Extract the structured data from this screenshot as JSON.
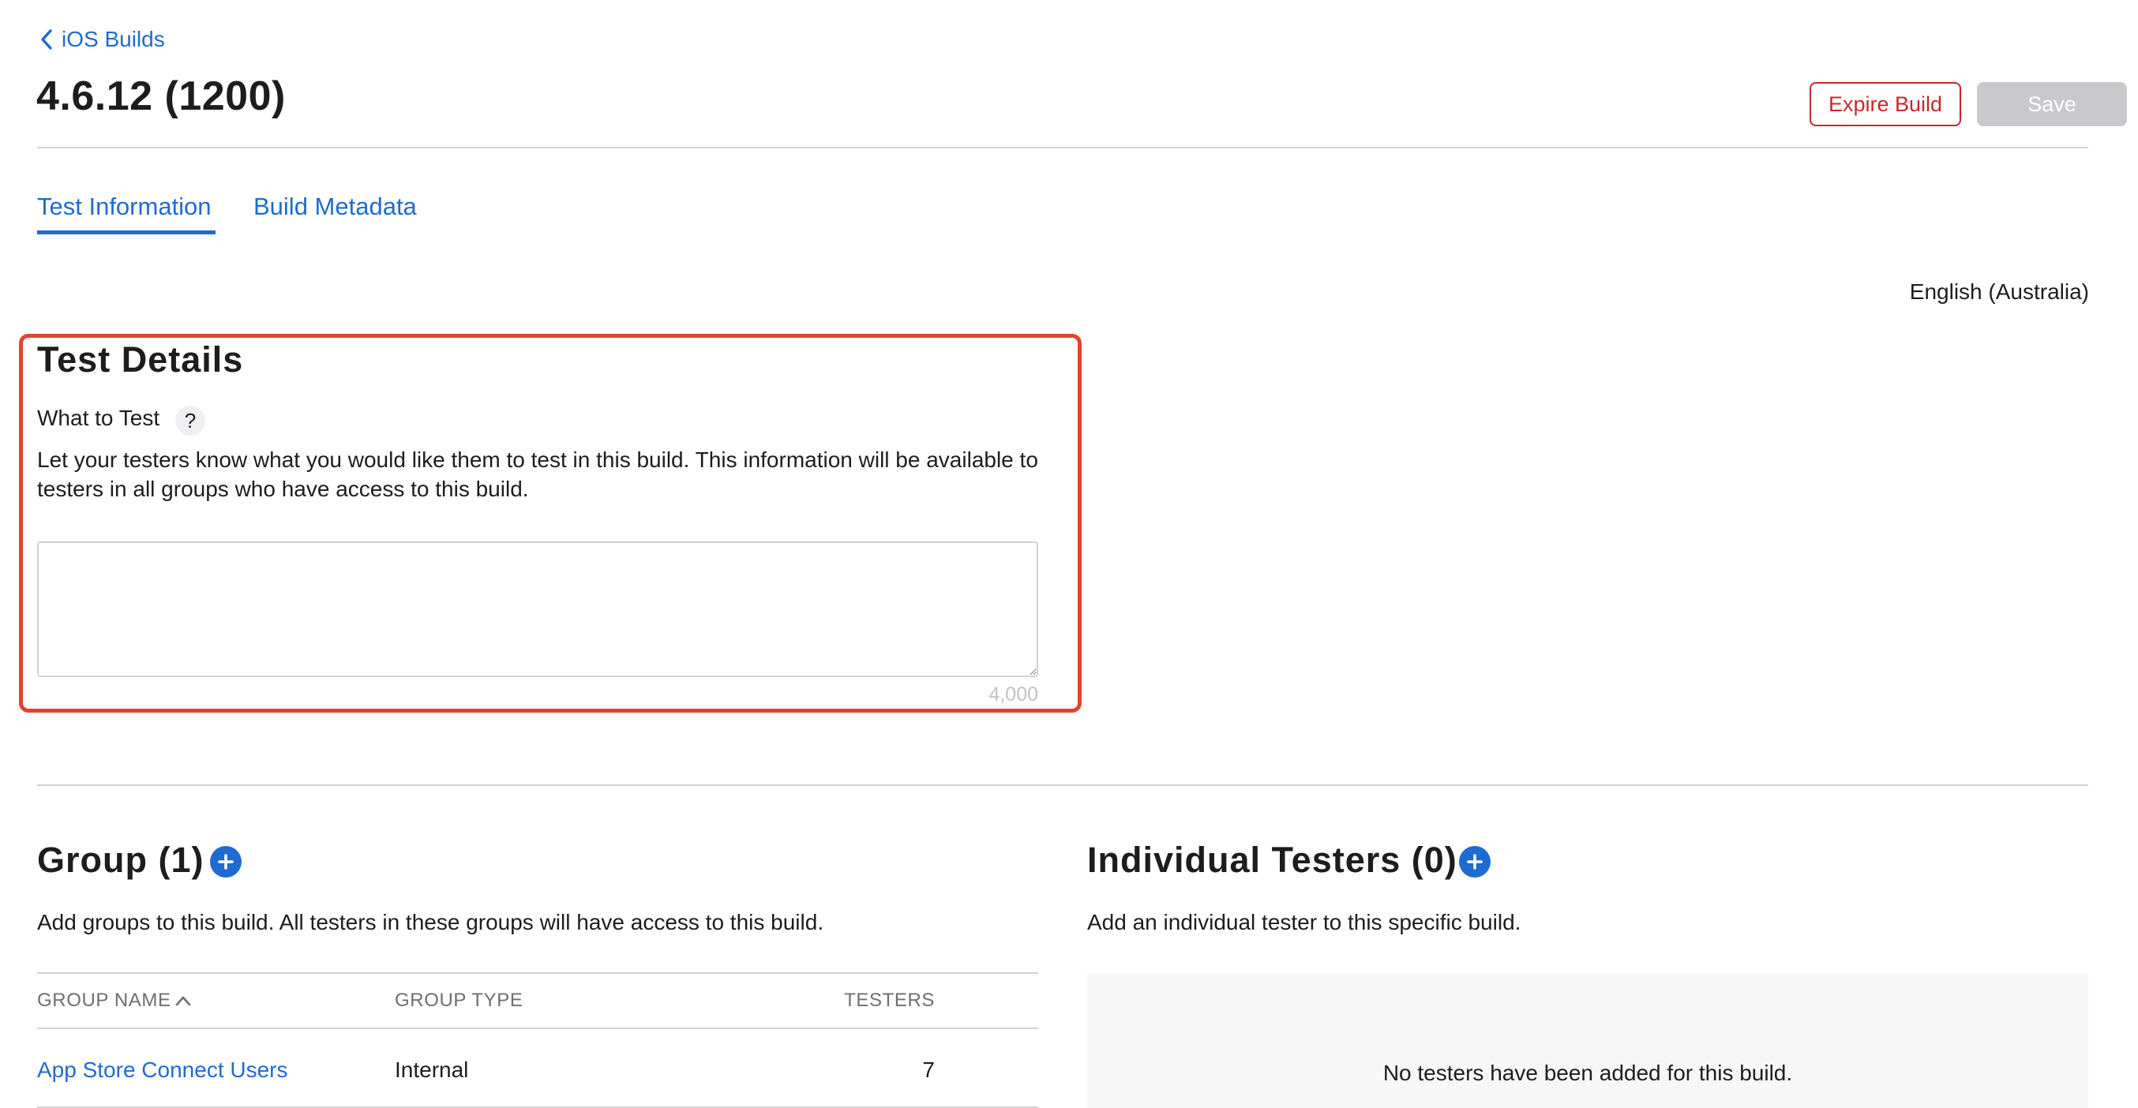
{
  "nav": {
    "back_label": "iOS Builds"
  },
  "header": {
    "title": "4.6.12 (1200)",
    "expire_label": "Expire Build",
    "save_label": "Save"
  },
  "tabs": [
    {
      "label": "Test Information",
      "active": true
    },
    {
      "label": "Build Metadata",
      "active": false
    }
  ],
  "locale": "English (Australia)",
  "test_details": {
    "title": "Test Details",
    "field_label": "What to Test",
    "help_glyph": "?",
    "description_line1": "Let your testers know what you would like them to test in this build. This information will be available to",
    "description_line2": "testers in all groups who have access to this build.",
    "textarea_value": "",
    "char_count": "4,000"
  },
  "groups": {
    "title": "Group (1)",
    "description": "Add groups to this build. All testers in these groups will have access to this build.",
    "columns": {
      "name": "GROUP NAME",
      "type": "GROUP TYPE",
      "testers": "TESTERS"
    },
    "rows": [
      {
        "name": "App Store Connect Users",
        "type": "Internal",
        "testers": "7"
      }
    ]
  },
  "individual_testers": {
    "title": "Individual Testers (0)",
    "description": "Add an individual tester to this specific build.",
    "empty_message": "No testers have been added for this build."
  },
  "colors": {
    "link": "#1f6bd0",
    "danger": "#c52a2a",
    "highlight": "#e4412f",
    "disabled": "#c9c9cb"
  }
}
